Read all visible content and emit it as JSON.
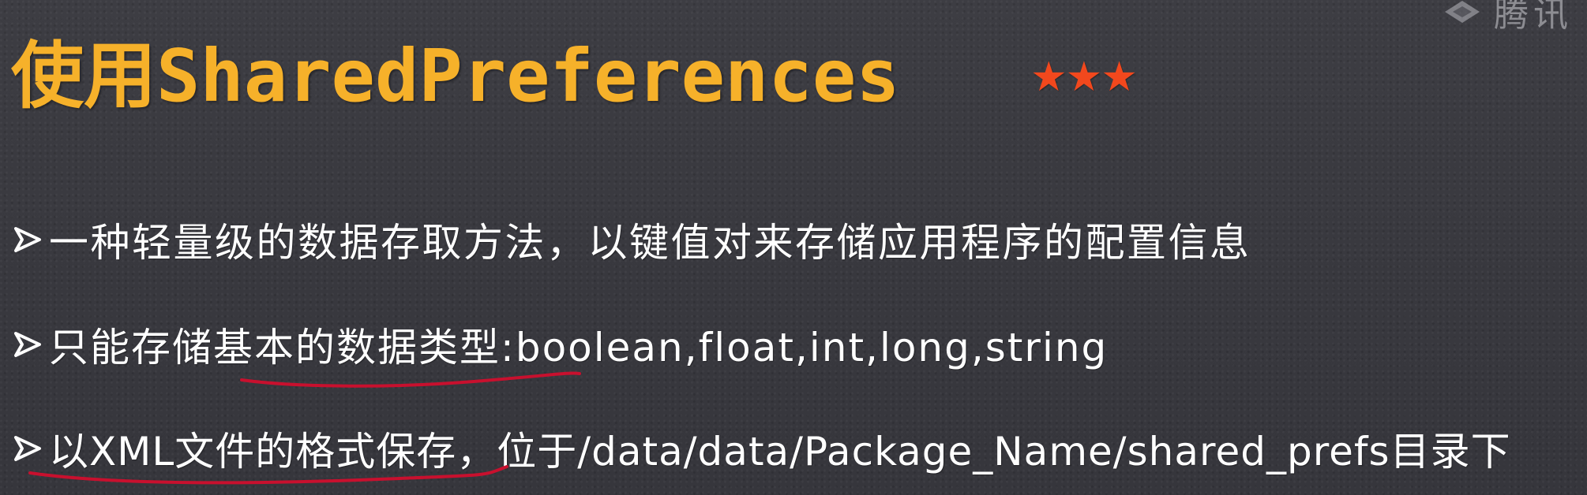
{
  "slide": {
    "title": "使用SharedPreferences",
    "rating_stars": "★★★",
    "watermark_text": "腾讯",
    "bullets": [
      {
        "text": "一种轻量级的数据存取方法，以键值对来存储应用程序的配置信息"
      },
      {
        "text": "只能存储基本的数据类型:boolean,float,int,long,string"
      },
      {
        "text": "以XML文件的格式保存，位于/data/data/Package_Name/shared_prefs目录下"
      }
    ]
  },
  "colors": {
    "background": "#3a3a40",
    "title": "#f6b12a",
    "stars": "#f2481d",
    "body_text": "#ffffff",
    "annotation_underline": "#c8102e"
  },
  "icons": {
    "bullet": "arrowhead-bullet-icon",
    "watermark": "tencent-classroom-logo-icon"
  }
}
